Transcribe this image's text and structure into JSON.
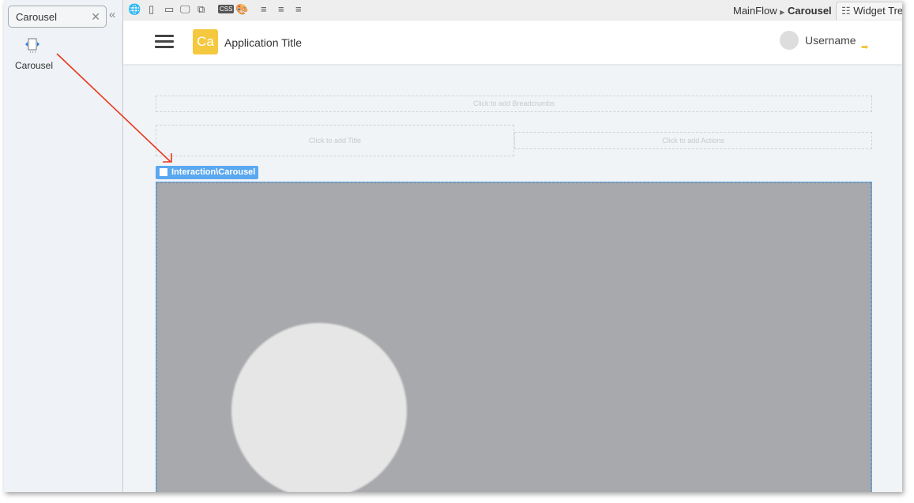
{
  "sidebar": {
    "search_value": "Carousel",
    "widget_label": "Carousel"
  },
  "toolbar": {
    "breadcrumb_flow": "MainFlow",
    "breadcrumb_screen": "Carousel",
    "widget_tree": "Widget Tree",
    "css_label": "CSS"
  },
  "header": {
    "logo": "Ca",
    "app_title": "Application Title",
    "username": "Username"
  },
  "canvas": {
    "breadcrumbs_placeholder": "Click to add Breadcrumbs",
    "title_placeholder": "Click to add Title",
    "actions_placeholder": "Click to add Actions",
    "selected_widget": "Interaction\\Carousel"
  },
  "colors": {
    "accent": "#5aa8f0",
    "logo": "#f4c83f",
    "arrow": "#e8391e"
  }
}
